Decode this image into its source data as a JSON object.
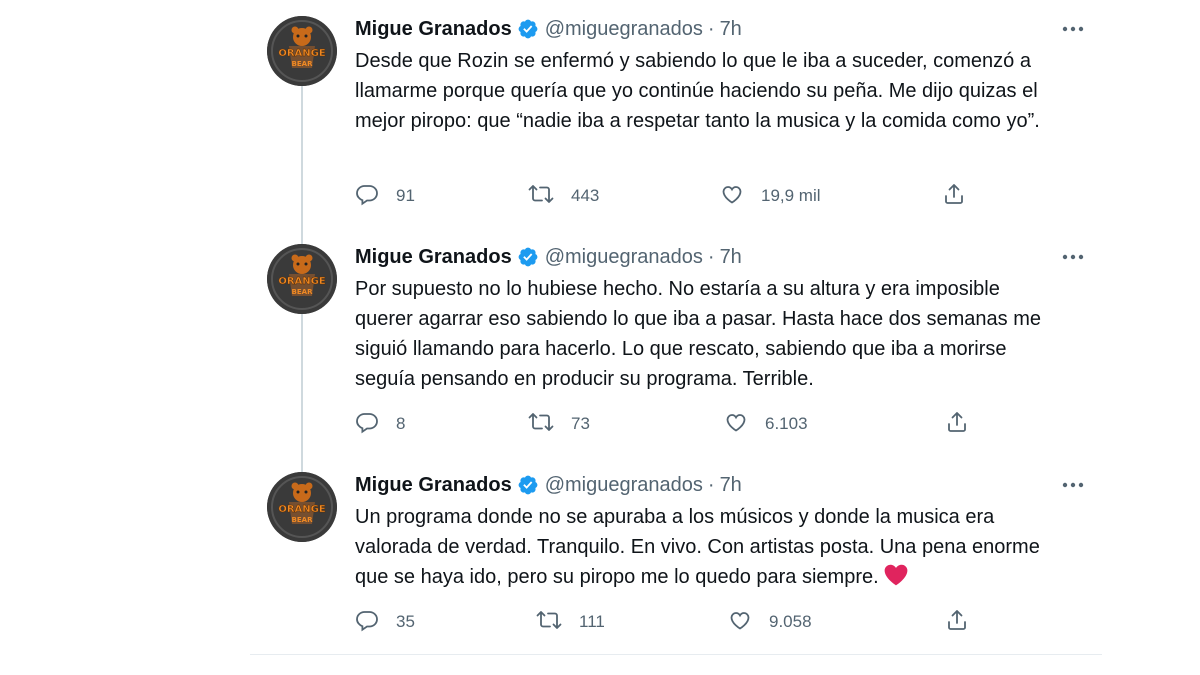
{
  "tweets": [
    {
      "name": "Migue Granados",
      "handle": "@miguegranados",
      "separator": "·",
      "time": "7h",
      "text": "Desde que Rozin se enfermó y sabiendo lo que le iba a suceder, comenzó a llamarme porque quería que yo continúe haciendo su peña. Me dijo quizas el mejor piropo: que “nadie iba a respetar tanto la musica y la comida como yo”.",
      "replies": "91",
      "retweets": "443",
      "likes": "19,9 mil"
    },
    {
      "name": "Migue Granados",
      "handle": "@miguegranados",
      "separator": "·",
      "time": "7h",
      "text": "Por supuesto no lo hubiese hecho. No estaría a su altura y era imposible querer agarrar eso sabiendo lo que iba a pasar. Hasta hace dos semanas me siguió llamando para hacerlo. Lo que rescato, sabiendo que iba a morirse seguía pensando en producir su programa. Terrible.",
      "replies": "8",
      "retweets": "73",
      "likes": "6.103"
    },
    {
      "name": "Migue Granados",
      "handle": "@miguegranados",
      "separator": "·",
      "time": "7h",
      "text": "Un programa donde no se apuraba a los músicos y donde la musica era valorada de verdad. Tranquilo. En vivo. Con artistas posta. Una pena enorme que se haya ido, pero su piropo me lo quedo para siempre.",
      "replies": "35",
      "retweets": "111",
      "likes": "9.058"
    }
  ],
  "avatar_logo": {
    "line1": "ORANGE",
    "line2": "BEAR"
  },
  "icons": [
    "verified-badge-icon",
    "more-options-icon",
    "reply-icon",
    "retweet-icon",
    "like-icon",
    "share-icon",
    "red-heart-emoji"
  ],
  "colors": {
    "text": "#0f1419",
    "secondary": "#536471",
    "verified": "#1d9bf0",
    "thread_line": "#cfd9de",
    "heart": "#e0245e",
    "avatar_orange": "#e8781f"
  }
}
